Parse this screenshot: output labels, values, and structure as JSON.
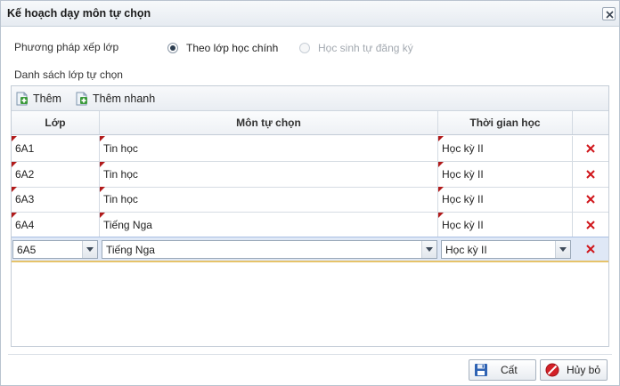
{
  "dialog": {
    "title": "Kế hoạch dạy môn tự chọn"
  },
  "method": {
    "label": "Phương pháp xếp lớp",
    "options": [
      {
        "label": "Theo lớp học chính",
        "checked": true,
        "disabled": false
      },
      {
        "label": "Học sinh tự đăng ký",
        "checked": false,
        "disabled": true
      }
    ]
  },
  "list": {
    "label": "Danh sách lớp tự chọn"
  },
  "toolbar": {
    "add_label": "Thêm",
    "quick_add_label": "Thêm nhanh"
  },
  "table": {
    "columns": [
      "Lớp",
      "Môn tự chọn",
      "Thời gian học"
    ],
    "rows": [
      {
        "class": "6A1",
        "subject": "Tin học",
        "term": "Học kỳ II"
      },
      {
        "class": "6A2",
        "subject": "Tin học",
        "term": "Học kỳ II"
      },
      {
        "class": "6A3",
        "subject": "Tin học",
        "term": "Học kỳ II"
      },
      {
        "class": "6A4",
        "subject": "Tiếng Nga",
        "term": "Học kỳ II"
      }
    ],
    "editing_row": {
      "class": "6A5",
      "subject": "Tiếng Nga",
      "term": "Học kỳ II"
    }
  },
  "buttons": {
    "save_label": "Cất",
    "cancel_label": "Hủy bỏ"
  },
  "colors": {
    "delete_icon": "#d0161b",
    "add_icon": "#3c9a3c",
    "editing_row": "#dfe8f6"
  }
}
